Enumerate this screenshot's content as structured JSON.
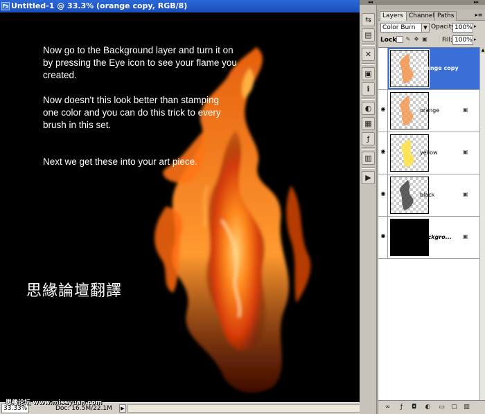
{
  "window": {
    "title": "Untitled-1 @ 33.3% (orange copy, RGB/8)",
    "app_icon": "Ps"
  },
  "canvas": {
    "paragraph_1": "Now go to the Background layer and turn it on\nby pressing the Eye icon to see your flame you\ncreated.",
    "paragraph_2": "Now doesn't this look better than stamping\none color and you can do this trick to every\nbrush in this set.",
    "paragraph_3": "Next we get these into your art piece.",
    "watermark": "思緣論壇翻譯"
  },
  "statusbar": {
    "zoom": "33.33%",
    "doc_info": "Doc: 16.5M/22.1M",
    "site_watermark": "思缘论坛  www.missyuan.com"
  },
  "dock": {
    "collapse_left": "◂◂",
    "collapse_right": "▸▸"
  },
  "tool_strip": {
    "icons": [
      "navigator-icon",
      "histogram-icon",
      "brushes-icon",
      "tool-presets-icon",
      "info-icon",
      "color-icon",
      "swatches-icon",
      "styles-icon",
      "history-icon",
      "actions-icon"
    ]
  },
  "layers_panel": {
    "tabs": [
      {
        "label": "Layers ×",
        "active": true
      },
      {
        "label": "Channels",
        "active": false
      },
      {
        "label": "Paths",
        "active": false
      }
    ],
    "menu_glyph": "▸≡",
    "blend_mode": "Color Burn",
    "opacity_label": "Opacity:",
    "opacity_value": "100%",
    "lock_label": "Lock:",
    "fill_label": "Fill:",
    "fill_value": "100%",
    "layers": [
      {
        "name": "orange copy",
        "selected": true,
        "visible": false,
        "locked": false,
        "thumb_color": "#f39a55"
      },
      {
        "name": "orange",
        "selected": false,
        "visible": true,
        "locked": true,
        "thumb_color": "#f39a55"
      },
      {
        "name": "yellow",
        "selected": false,
        "visible": true,
        "locked": true,
        "thumb_color": "#ffe34a"
      },
      {
        "name": "black",
        "selected": false,
        "visible": true,
        "locked": true,
        "thumb_color": "#444444"
      },
      {
        "name": "Backgro...",
        "selected": false,
        "visible": true,
        "locked": true,
        "thumb_color": "#000000"
      }
    ]
  },
  "colors": {
    "titlebar": "#2a67d8",
    "selection": "#3a6fd8",
    "panel_bg": "#d4d0c8"
  }
}
